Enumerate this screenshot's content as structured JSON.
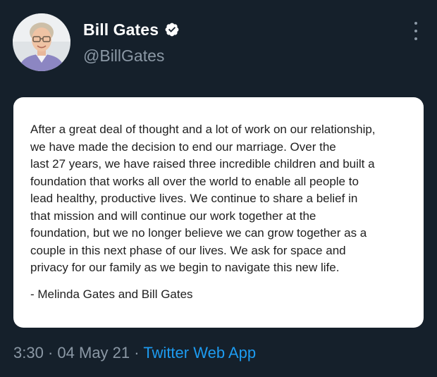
{
  "tweet": {
    "author": {
      "display_name": "Bill Gates",
      "handle": "@BillGates",
      "verified_icon": "verified-badge-icon",
      "avatar": "profile-photo"
    },
    "more_icon": "more-options-icon",
    "image_card": {
      "statement": "After a great deal of thought and a lot of work on our relationship,\nwe have made the decision to end our marriage. Over the\nlast 27 years, we have raised three incredible children and built a\nfoundation that works all over the world to enable all people to\nlead healthy, productive lives. We continue to share a belief in\nthat mission and will continue our work together at the\nfoundation, but we no longer believe we can grow together as a\ncouple in this next phase of our lives. We ask for space and\nprivacy for our family as we begin to navigate this new life.",
      "signature": "- Melinda Gates and Bill Gates"
    },
    "meta": {
      "time": "3:30",
      "separator": "·",
      "date": "04 May 21",
      "source": "Twitter Web App"
    }
  },
  "colors": {
    "background": "#15202b",
    "secondary_text": "#8b98a5",
    "link": "#1d9bf0",
    "card": "#ffffff"
  }
}
